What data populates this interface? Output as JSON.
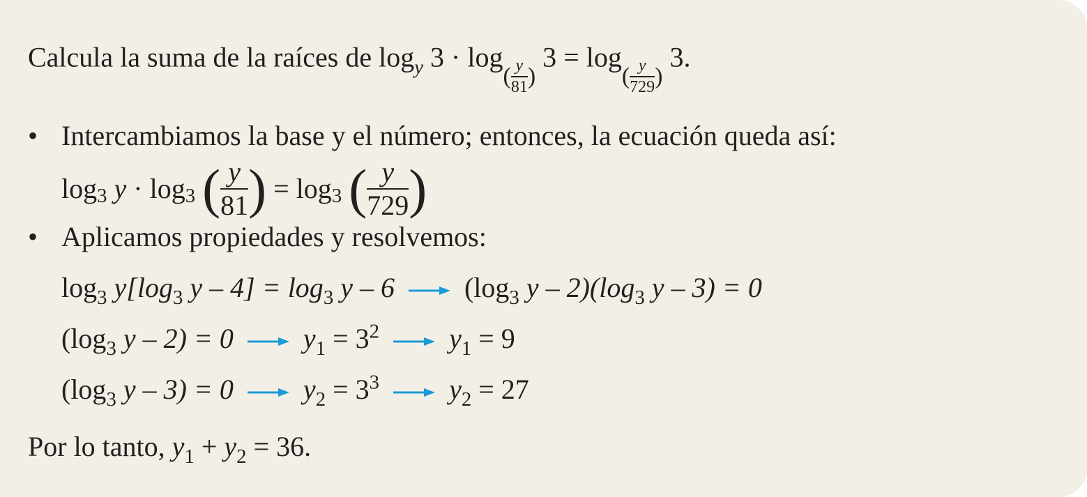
{
  "problem": {
    "prefix": "Calcula la suma de la raíces de",
    "log": "log",
    "var": "y",
    "three": "3",
    "dot": "·",
    "eq": "=",
    "period": ".",
    "frac1_num": "y",
    "frac1_den": "81",
    "frac2_num": "y",
    "frac2_den": "729"
  },
  "step1": {
    "text": "Intercambiamos la base y el número; entonces, la ecuación queda así:",
    "base": "3",
    "frac1_den": "81",
    "frac2_den": "729"
  },
  "step2": {
    "text": "Aplicamos propiedades y resolvemos:"
  },
  "work": {
    "line1_a": "log",
    "line1_b": "y[log",
    "line1_c": "y – 4] = log",
    "line1_d": "y – 6",
    "line1_e": "(log",
    "line1_f": "y – 2)(log",
    "line1_g": "y – 3) = 0",
    "line2_a": "(log",
    "line2_b": "y – 2) = 0",
    "line2_c": "y",
    "line2_sub": "1",
    "line2_d": "= 3",
    "line2_sup": "2",
    "line2_e": "y",
    "line2_f": "= 9",
    "line3_a": "(log",
    "line3_b": "y – 3) = 0",
    "line3_c": "y",
    "line3_sub": "2",
    "line3_d": "= 3",
    "line3_sup": "3",
    "line3_e": "y",
    "line3_f": "= 27"
  },
  "conclusion": {
    "prefix": "Por lo tanto,",
    "y": "y",
    "sub1": "1",
    "plus": "+",
    "sub2": "2",
    "result": "= 36."
  },
  "colors": {
    "arrow": "#1a9ad6",
    "background": "#f2f0e6",
    "text": "#231f20"
  },
  "icons": {
    "bullet": "•",
    "arrow": "right-arrow-icon"
  }
}
